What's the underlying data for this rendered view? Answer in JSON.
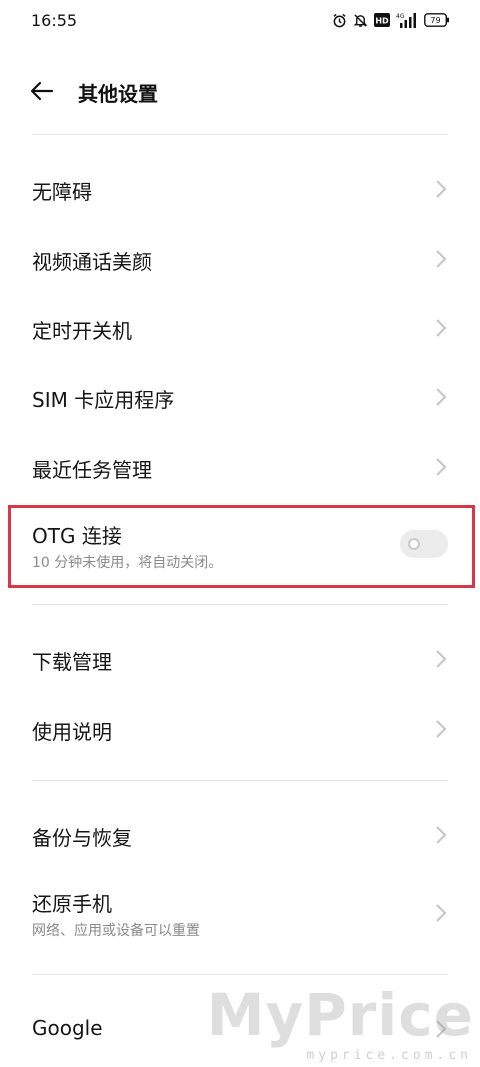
{
  "status_bar": {
    "time": "16:55",
    "network": "4G",
    "hd": "HD",
    "battery": "79",
    "icons": [
      "alarm-icon",
      "mute-icon",
      "hd-icon",
      "signal-icon",
      "battery-icon"
    ]
  },
  "header": {
    "title": "其他设置"
  },
  "items": [
    {
      "label": "无障碍"
    },
    {
      "label": "视频通话美颜"
    },
    {
      "label": "定时开关机"
    },
    {
      "label": "SIM 卡应用程序"
    },
    {
      "label": "最近任务管理"
    },
    {
      "label": "OTG 连接",
      "subtitle": "10 分钟未使用，将自动关闭。",
      "toggle_on": false
    },
    {
      "label": "下载管理"
    },
    {
      "label": "使用说明"
    },
    {
      "label": "备份与恢复"
    },
    {
      "label": "还原手机",
      "subtitle": "网络、应用或设备可以重置"
    },
    {
      "label": "Google"
    }
  ],
  "watermark": {
    "main": "MyPrice",
    "sub": "myprice.com.cn"
  },
  "colors": {
    "highlight": "#d9364a",
    "divider": "#e6e6e6",
    "chevron": "#c4c4c4"
  }
}
